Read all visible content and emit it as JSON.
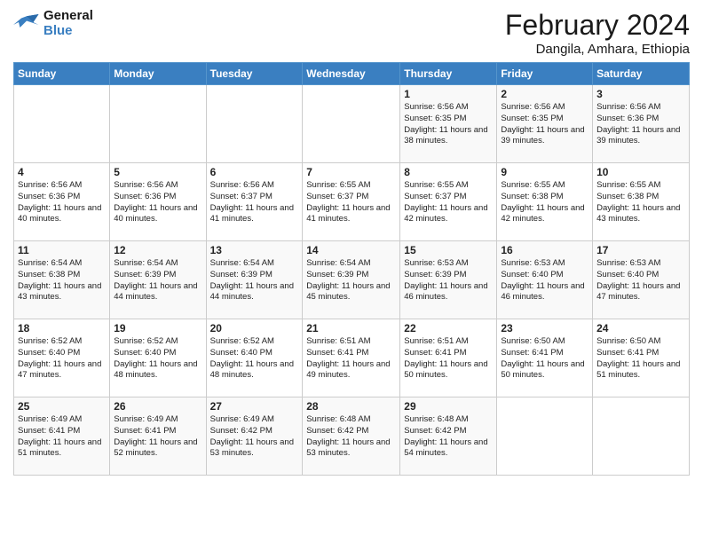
{
  "logo": {
    "line1": "General",
    "line2": "Blue"
  },
  "title": "February 2024",
  "location": "Dangila, Amhara, Ethiopia",
  "days_of_week": [
    "Sunday",
    "Monday",
    "Tuesday",
    "Wednesday",
    "Thursday",
    "Friday",
    "Saturday"
  ],
  "weeks": [
    [
      {
        "day": "",
        "info": ""
      },
      {
        "day": "",
        "info": ""
      },
      {
        "day": "",
        "info": ""
      },
      {
        "day": "",
        "info": ""
      },
      {
        "day": "1",
        "info": "Sunrise: 6:56 AM\nSunset: 6:35 PM\nDaylight: 11 hours\nand 38 minutes."
      },
      {
        "day": "2",
        "info": "Sunrise: 6:56 AM\nSunset: 6:35 PM\nDaylight: 11 hours\nand 39 minutes."
      },
      {
        "day": "3",
        "info": "Sunrise: 6:56 AM\nSunset: 6:36 PM\nDaylight: 11 hours\nand 39 minutes."
      }
    ],
    [
      {
        "day": "4",
        "info": "Sunrise: 6:56 AM\nSunset: 6:36 PM\nDaylight: 11 hours\nand 40 minutes."
      },
      {
        "day": "5",
        "info": "Sunrise: 6:56 AM\nSunset: 6:36 PM\nDaylight: 11 hours\nand 40 minutes."
      },
      {
        "day": "6",
        "info": "Sunrise: 6:56 AM\nSunset: 6:37 PM\nDaylight: 11 hours\nand 41 minutes."
      },
      {
        "day": "7",
        "info": "Sunrise: 6:55 AM\nSunset: 6:37 PM\nDaylight: 11 hours\nand 41 minutes."
      },
      {
        "day": "8",
        "info": "Sunrise: 6:55 AM\nSunset: 6:37 PM\nDaylight: 11 hours\nand 42 minutes."
      },
      {
        "day": "9",
        "info": "Sunrise: 6:55 AM\nSunset: 6:38 PM\nDaylight: 11 hours\nand 42 minutes."
      },
      {
        "day": "10",
        "info": "Sunrise: 6:55 AM\nSunset: 6:38 PM\nDaylight: 11 hours\nand 43 minutes."
      }
    ],
    [
      {
        "day": "11",
        "info": "Sunrise: 6:54 AM\nSunset: 6:38 PM\nDaylight: 11 hours\nand 43 minutes."
      },
      {
        "day": "12",
        "info": "Sunrise: 6:54 AM\nSunset: 6:39 PM\nDaylight: 11 hours\nand 44 minutes."
      },
      {
        "day": "13",
        "info": "Sunrise: 6:54 AM\nSunset: 6:39 PM\nDaylight: 11 hours\nand 44 minutes."
      },
      {
        "day": "14",
        "info": "Sunrise: 6:54 AM\nSunset: 6:39 PM\nDaylight: 11 hours\nand 45 minutes."
      },
      {
        "day": "15",
        "info": "Sunrise: 6:53 AM\nSunset: 6:39 PM\nDaylight: 11 hours\nand 46 minutes."
      },
      {
        "day": "16",
        "info": "Sunrise: 6:53 AM\nSunset: 6:40 PM\nDaylight: 11 hours\nand 46 minutes."
      },
      {
        "day": "17",
        "info": "Sunrise: 6:53 AM\nSunset: 6:40 PM\nDaylight: 11 hours\nand 47 minutes."
      }
    ],
    [
      {
        "day": "18",
        "info": "Sunrise: 6:52 AM\nSunset: 6:40 PM\nDaylight: 11 hours\nand 47 minutes."
      },
      {
        "day": "19",
        "info": "Sunrise: 6:52 AM\nSunset: 6:40 PM\nDaylight: 11 hours\nand 48 minutes."
      },
      {
        "day": "20",
        "info": "Sunrise: 6:52 AM\nSunset: 6:40 PM\nDaylight: 11 hours\nand 48 minutes."
      },
      {
        "day": "21",
        "info": "Sunrise: 6:51 AM\nSunset: 6:41 PM\nDaylight: 11 hours\nand 49 minutes."
      },
      {
        "day": "22",
        "info": "Sunrise: 6:51 AM\nSunset: 6:41 PM\nDaylight: 11 hours\nand 50 minutes."
      },
      {
        "day": "23",
        "info": "Sunrise: 6:50 AM\nSunset: 6:41 PM\nDaylight: 11 hours\nand 50 minutes."
      },
      {
        "day": "24",
        "info": "Sunrise: 6:50 AM\nSunset: 6:41 PM\nDaylight: 11 hours\nand 51 minutes."
      }
    ],
    [
      {
        "day": "25",
        "info": "Sunrise: 6:49 AM\nSunset: 6:41 PM\nDaylight: 11 hours\nand 51 minutes."
      },
      {
        "day": "26",
        "info": "Sunrise: 6:49 AM\nSunset: 6:41 PM\nDaylight: 11 hours\nand 52 minutes."
      },
      {
        "day": "27",
        "info": "Sunrise: 6:49 AM\nSunset: 6:42 PM\nDaylight: 11 hours\nand 53 minutes."
      },
      {
        "day": "28",
        "info": "Sunrise: 6:48 AM\nSunset: 6:42 PM\nDaylight: 11 hours\nand 53 minutes."
      },
      {
        "day": "29",
        "info": "Sunrise: 6:48 AM\nSunset: 6:42 PM\nDaylight: 11 hours\nand 54 minutes."
      },
      {
        "day": "",
        "info": ""
      },
      {
        "day": "",
        "info": ""
      }
    ]
  ]
}
